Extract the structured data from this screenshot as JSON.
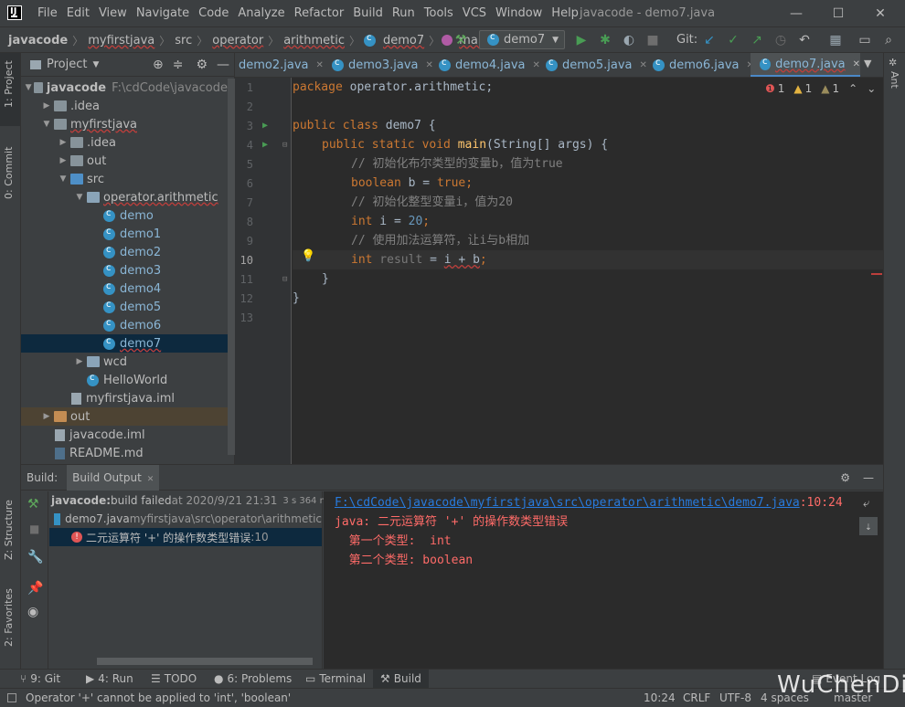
{
  "menubar": {
    "logo": "IJ",
    "items": [
      "File",
      "Edit",
      "View",
      "Navigate",
      "Code",
      "Analyze",
      "Refactor",
      "Build",
      "Run",
      "Tools",
      "VCS",
      "Window",
      "Help"
    ],
    "window_title": "javacode - demo7.java",
    "minimize": "—",
    "maximize": "☐",
    "close": "✕"
  },
  "navbar": {
    "breadcrumbs": [
      "javacode",
      "myfirstjava",
      "src",
      "operator",
      "arithmetic",
      "demo7",
      "main"
    ],
    "run_config": "demo7",
    "git_label": "Git:"
  },
  "left_strip": {
    "project": "1: Project",
    "commit": "0: Commit",
    "structure": "Z: Structure",
    "favorites": "2: Favorites"
  },
  "right_strip": {
    "ant": "Ant"
  },
  "project": {
    "title": "Project",
    "tree": [
      {
        "label": "javacode",
        "path": "F:\\cdCode\\javacode"
      },
      {
        "label": ".idea"
      },
      {
        "label": "myfirstjava"
      },
      {
        "label": ".idea"
      },
      {
        "label": "out"
      },
      {
        "label": "src"
      },
      {
        "label": "operator.arithmetic"
      },
      {
        "label": "demo"
      },
      {
        "label": "demo1"
      },
      {
        "label": "demo2"
      },
      {
        "label": "demo3"
      },
      {
        "label": "demo4"
      },
      {
        "label": "demo5"
      },
      {
        "label": "demo6"
      },
      {
        "label": "demo7"
      },
      {
        "label": "wcd"
      },
      {
        "label": "HelloWorld"
      },
      {
        "label": "myfirstjava.iml"
      },
      {
        "label": "out"
      },
      {
        "label": "javacode.iml"
      },
      {
        "label": "README.md"
      }
    ]
  },
  "tabs": [
    "demo2.java",
    "demo3.java",
    "demo4.java",
    "demo5.java",
    "demo6.java",
    "demo7.java"
  ],
  "editor": {
    "inspections": {
      "errors": "1",
      "warnings": "1",
      "weak": "1"
    },
    "lines": [
      "1",
      "2",
      "3",
      "4",
      "5",
      "6",
      "7",
      "8",
      "9",
      "10",
      "11",
      "12",
      "13"
    ],
    "code": {
      "l1_kw": "package",
      "l1_rest": " operator.arithmetic;",
      "l3_kw": "public class",
      "l3_rest": " demo7 {",
      "l4_kw": "public static void",
      "l4_fn": "main",
      "l4_rest": "(String[] args) {",
      "l5": "// 初始化布尔类型的变量b，值为true",
      "l6_kw": "boolean",
      "l6_mid": " b = ",
      "l6_val": "true;",
      "l7": "// 初始化整型变量i，值为20",
      "l8_kw": "int",
      "l8_mid": " i = ",
      "l8_val": "20",
      ";": ";",
      "l9": "// 使用加法运算符，让i与b相加",
      "l10_kw": "int",
      "l10_var": " result",
      "l10_rest": " = ",
      "l10_expr": "i + b",
      "l10_end": ";",
      "l11": "}",
      "l12": "}"
    }
  },
  "build": {
    "label": "Build:",
    "tab": "Build Output",
    "tree": {
      "project": "javacode:",
      "status": " build failed",
      "time": " at 2020/9/21 21:31",
      "duration": "3 s 364 ms",
      "file": "demo7.java",
      "file_path": " myfirstjava\\src\\operator\\arithmetic",
      "error": "二元运算符 '+' 的操作数类型错误",
      "error_line": " :10"
    },
    "output": {
      "link": "F:\\cdCode\\javacode\\myfirstjava\\src\\operator\\arithmetic\\demo7.java",
      "loc": ":10:24",
      "msg": "java: 二元运算符 '+' 的操作数类型错误",
      "t1": "  第一个类型:  int",
      "t2": "  第二个类型: boolean"
    }
  },
  "toolwindows": [
    "9: Git",
    "4: Run",
    "TODO",
    "6: Problems",
    "Terminal",
    "Build",
    "Event Log"
  ],
  "status": {
    "message": "Operator '+' cannot be applied to 'int', 'boolean'",
    "position": "10:24",
    "line_sep": "CRLF",
    "encoding": "UTF-8",
    "indent": "4 spaces",
    "branch": "master"
  },
  "watermark": "WuChenDi"
}
